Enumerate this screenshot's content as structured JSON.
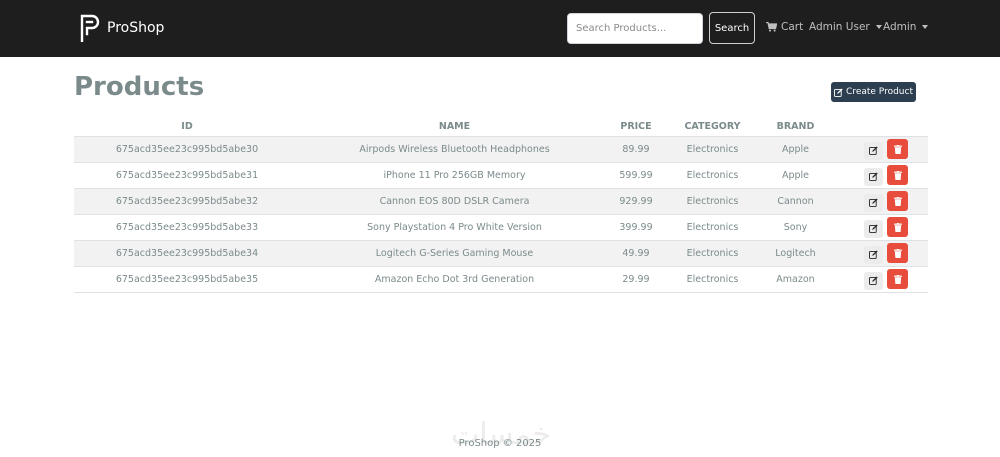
{
  "navbar": {
    "brand": "ProShop",
    "search_placeholder": "Search Products...",
    "search_button": "Search",
    "cart_label": "Cart",
    "user_menu_label": "Admin User",
    "admin_menu_label": "Admin",
    "icons": {
      "logo": "proshop-logo-icon",
      "cart": "cart-icon"
    }
  },
  "page": {
    "title": "Products",
    "create_button": "Create Product"
  },
  "table": {
    "headers": [
      "ID",
      "NAME",
      "PRICE",
      "CATEGORY",
      "BRAND"
    ],
    "rows": [
      [
        "675acd35ee23c995bd5abe30",
        "Airpods Wireless Bluetooth Headphones",
        "89.99",
        "Electronics",
        "Apple"
      ],
      [
        "675acd35ee23c995bd5abe31",
        "iPhone 11 Pro 256GB Memory",
        "599.99",
        "Electronics",
        "Apple"
      ],
      [
        "675acd35ee23c995bd5abe32",
        "Cannon EOS 80D DSLR Camera",
        "929.99",
        "Electronics",
        "Cannon"
      ],
      [
        "675acd35ee23c995bd5abe33",
        "Sony Playstation 4 Pro White Version",
        "399.99",
        "Electronics",
        "Sony"
      ],
      [
        "675acd35ee23c995bd5abe34",
        "Logitech G-Series Gaming Mouse",
        "49.99",
        "Electronics",
        "Logitech"
      ],
      [
        "675acd35ee23c995bd5abe35",
        "Amazon Echo Dot 3rd Generation",
        "29.99",
        "Electronics",
        "Amazon"
      ]
    ]
  },
  "footer": {
    "text": "ProShop © 2025",
    "watermark": "خمسات"
  },
  "colors": {
    "navbar_bg": "#1e1e1e",
    "primary": "#2c3e50",
    "danger": "#e74c3c",
    "text": "#7b8a8b",
    "stripe": "#f2f2f2"
  }
}
